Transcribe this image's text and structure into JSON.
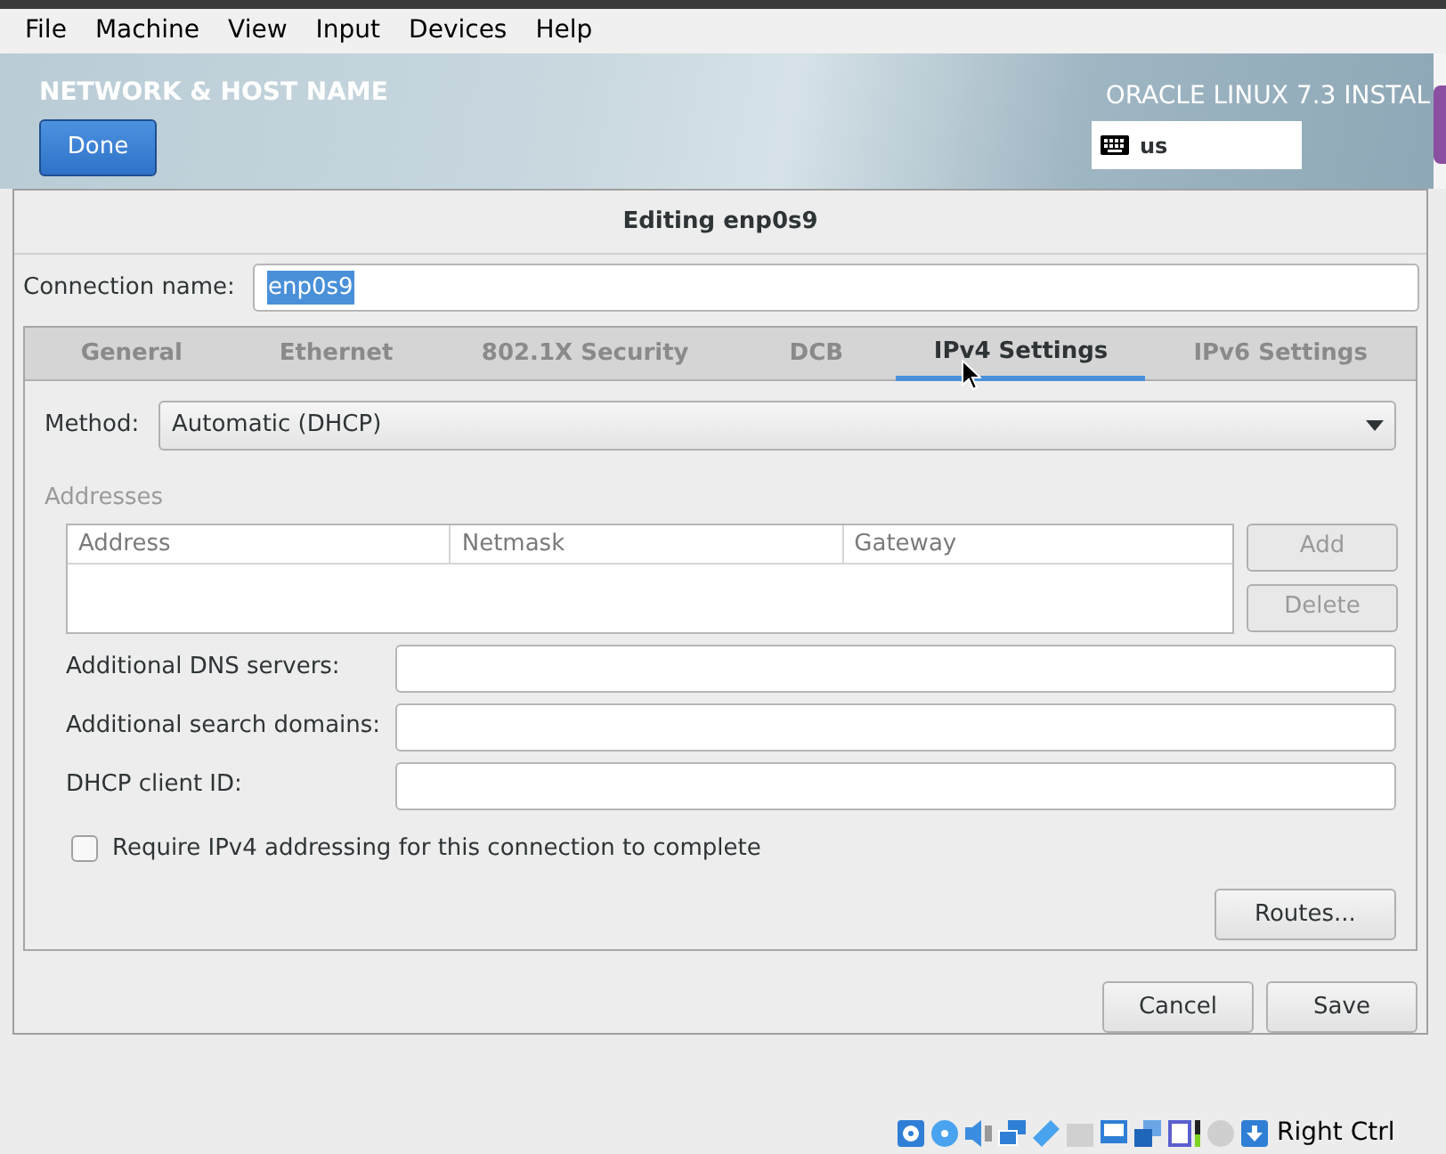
{
  "menu": [
    {
      "label": "File"
    },
    {
      "label": "Machine"
    },
    {
      "label": "View"
    },
    {
      "label": "Input"
    },
    {
      "label": "Devices"
    },
    {
      "label": "Help"
    }
  ],
  "header": {
    "title": "NETWORK & HOST NAME",
    "done_button": "Done",
    "product": "ORACLE LINUX 7.3 INSTAL",
    "keyboard_layout": "us"
  },
  "dialog": {
    "title": "Editing enp0s9",
    "connection_name": {
      "label": "Connection name:",
      "value": "enp0s9",
      "text_selected": true
    },
    "tabs": [
      {
        "label": "General",
        "selected": false
      },
      {
        "label": "Ethernet",
        "selected": false
      },
      {
        "label": "802.1X Security",
        "selected": false
      },
      {
        "label": "DCB",
        "selected": false
      },
      {
        "label": "IPv4 Settings",
        "selected": true
      },
      {
        "label": "IPv6 Settings",
        "selected": false
      }
    ],
    "method": {
      "label": "Method:",
      "value": "Automatic (DHCP)"
    },
    "addresses": {
      "heading": "Addresses",
      "disabled": true,
      "columns": [
        "Address",
        "Netmask",
        "Gateway"
      ],
      "buttons": [
        {
          "label": "Add",
          "disabled": true
        },
        {
          "label": "Delete",
          "disabled": true
        }
      ]
    },
    "fields": [
      {
        "label": "Additional DNS servers:"
      },
      {
        "label": "Additional search domains:"
      },
      {
        "label": "DHCP client ID:"
      }
    ],
    "require_checkbox": {
      "label": "Require IPv4 addressing for this connection to complete",
      "checked": false
    },
    "routes_button": "Routes...",
    "buttons": [
      "Cancel",
      "Save"
    ]
  },
  "status_bar": {
    "host_key": "Right Ctrl"
  }
}
